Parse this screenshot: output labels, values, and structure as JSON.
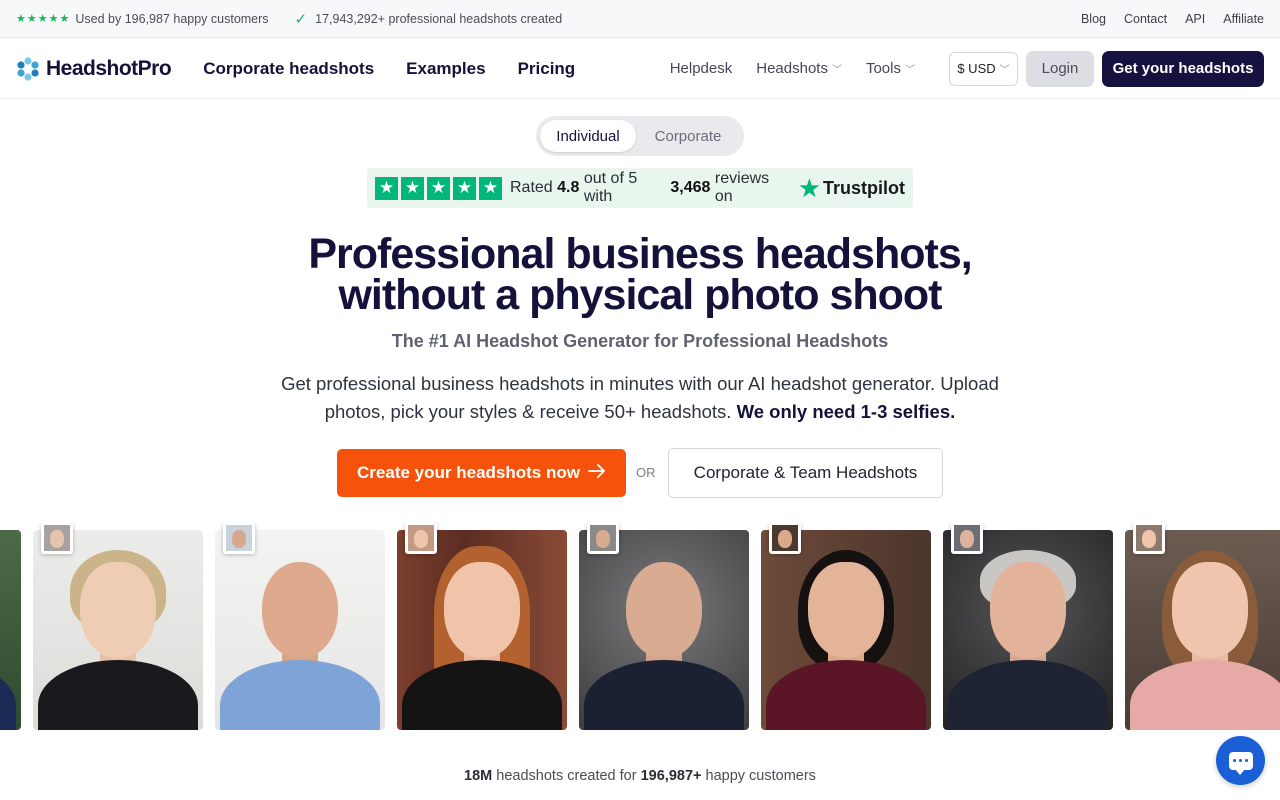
{
  "topbar": {
    "customers_text": "Used by 196,987 happy customers",
    "headshots_text": "17,943,292+ professional headshots created",
    "links": [
      "Blog",
      "Contact",
      "API",
      "Affiliate"
    ]
  },
  "nav": {
    "brand": "HeadshotPro",
    "main_links": [
      "Corporate headshots",
      "Examples",
      "Pricing"
    ],
    "helpdesk": "Helpdesk",
    "headshots": "Headshots",
    "tools": "Tools",
    "currency": "$ USD",
    "login": "Login",
    "cta": "Get your headshots"
  },
  "toggle": {
    "active": "Individual",
    "inactive": "Corporate"
  },
  "trustpilot": {
    "prefix": "Rated",
    "rating": "4.8",
    "middle": "out of 5 with",
    "count": "3,468",
    "suffix": "reviews on",
    "brand": "Trustpilot"
  },
  "hero": {
    "title_line1": "Professional business headshots,",
    "title_line2": "without a physical photo shoot",
    "subtitle": "The #1 AI Headshot Generator for Professional Headshots",
    "desc_part1": "Get professional business headshots in minutes with our AI headshot generator. Upload photos, pick your styles & receive 50+ headshots.",
    "desc_bold": "We only need 1-3 selfies.",
    "primary_cta": "Create your headshots now",
    "or": "OR",
    "secondary_cta": "Corporate & Team Headshots"
  },
  "stats": {
    "count": "18M",
    "mid": "headshots created for",
    "customers": "196,987+",
    "end": "happy customers"
  },
  "colors": {
    "brand_navy": "#15123f",
    "cta_orange": "#f5520c",
    "trust_green": "#00b67a",
    "chat_blue": "#1a5fd6"
  },
  "icons": [
    "star-icon",
    "check-icon",
    "chevron-down-icon",
    "arrow-right-icon",
    "chat-icon",
    "logo-icon"
  ]
}
